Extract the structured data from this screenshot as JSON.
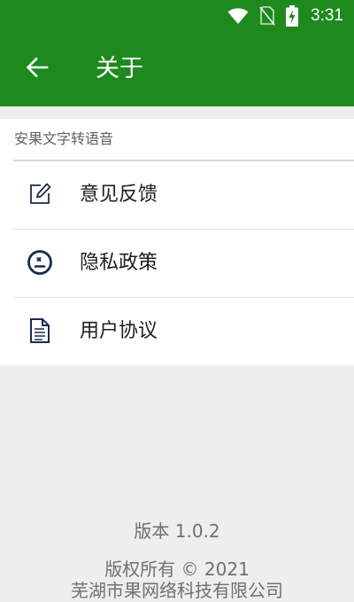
{
  "status_bar": {
    "time": "3:31",
    "icons": [
      "wifi-icon",
      "no-sim-icon",
      "battery-charging-icon"
    ]
  },
  "app_bar": {
    "back_icon": "arrow-left-icon",
    "title": "关于"
  },
  "section": {
    "header": "安果文字转语音",
    "items": [
      {
        "icon": "edit-icon",
        "label": "意见反馈"
      },
      {
        "icon": "policy-face-icon",
        "label": "隐私政策"
      },
      {
        "icon": "document-icon",
        "label": "用户协议"
      }
    ]
  },
  "footer": {
    "version": "版本 1.0.2",
    "copyright": "版权所有 © 2021",
    "company": "芜湖市果网络科技有限公司"
  },
  "colors": {
    "primary": "#1e8a1e",
    "background": "#eeeeee",
    "icon": "#1a2b4c"
  }
}
